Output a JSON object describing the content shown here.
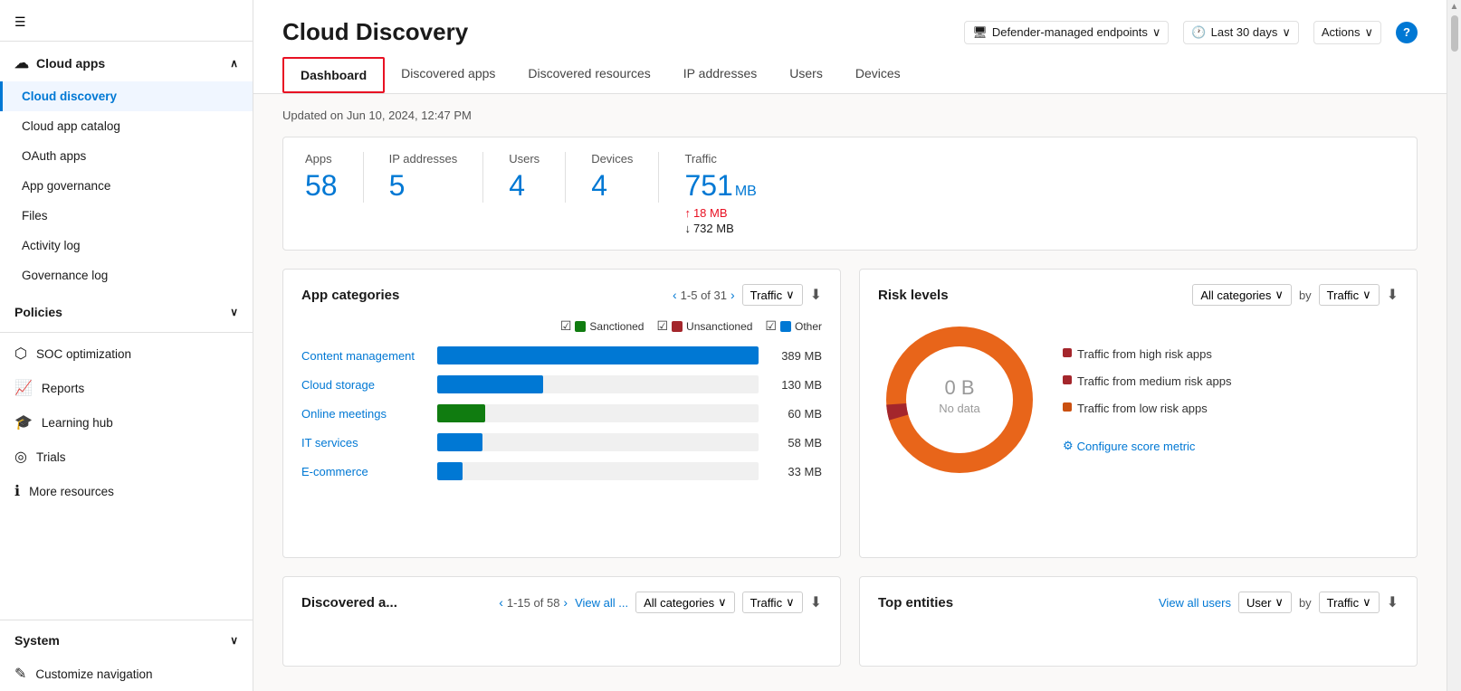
{
  "sidebar": {
    "hamburger": "☰",
    "cloud_apps": {
      "label": "Cloud apps",
      "icon": "☁",
      "chevron": "∧"
    },
    "items": [
      {
        "id": "cloud-discovery",
        "label": "Cloud discovery",
        "active": true
      },
      {
        "id": "cloud-app-catalog",
        "label": "Cloud app catalog",
        "active": false
      },
      {
        "id": "oauth-apps",
        "label": "OAuth apps",
        "active": false
      },
      {
        "id": "app-governance",
        "label": "App governance",
        "active": false
      },
      {
        "id": "files",
        "label": "Files",
        "active": false
      },
      {
        "id": "activity-log",
        "label": "Activity log",
        "active": false
      },
      {
        "id": "governance-log",
        "label": "Governance log",
        "active": false
      }
    ],
    "policies": {
      "label": "Policies",
      "chevron": "∨"
    },
    "divider1": true,
    "nav_items": [
      {
        "id": "soc-optimization",
        "label": "SOC optimization",
        "icon": "⬡"
      },
      {
        "id": "reports",
        "label": "Reports",
        "icon": "📈"
      },
      {
        "id": "learning-hub",
        "label": "Learning hub",
        "icon": "🎓"
      },
      {
        "id": "trials",
        "label": "Trials",
        "icon": "⊙"
      },
      {
        "id": "more-resources",
        "label": "More resources",
        "icon": "ℹ"
      }
    ],
    "divider2": true,
    "system": {
      "label": "System",
      "chevron": "∨"
    },
    "customize": {
      "label": "Customize navigation",
      "icon": "✎"
    }
  },
  "header": {
    "title": "Cloud Discovery",
    "updated_text": "Updated on Jun 10, 2024, 12:47 PM",
    "endpoints_btn": "Defender-managed endpoints",
    "time_btn": "Last 30 days",
    "actions_btn": "Actions",
    "help_label": "?"
  },
  "tabs": [
    {
      "id": "dashboard",
      "label": "Dashboard",
      "active": true
    },
    {
      "id": "discovered-apps",
      "label": "Discovered apps",
      "active": false
    },
    {
      "id": "discovered-resources",
      "label": "Discovered resources",
      "active": false
    },
    {
      "id": "ip-addresses",
      "label": "IP addresses",
      "active": false
    },
    {
      "id": "users",
      "label": "Users",
      "active": false
    },
    {
      "id": "devices",
      "label": "Devices",
      "active": false
    }
  ],
  "stats": [
    {
      "id": "apps",
      "label": "Apps",
      "value": "58"
    },
    {
      "id": "ip-addresses",
      "label": "IP addresses",
      "value": "5"
    },
    {
      "id": "users",
      "label": "Users",
      "value": "4"
    },
    {
      "id": "devices",
      "label": "Devices",
      "value": "4"
    },
    {
      "id": "traffic",
      "label": "Traffic",
      "value": "751",
      "unit": "MB",
      "up": "18 MB",
      "down": "732 MB"
    }
  ],
  "app_categories": {
    "title": "App categories",
    "pagination": "1-5 of 31",
    "filter": "Traffic",
    "legend": [
      {
        "label": "Sanctioned",
        "color": "#107c10"
      },
      {
        "label": "Unsanctioned",
        "color": "#a4262c"
      },
      {
        "label": "Other",
        "color": "#0078d4"
      }
    ],
    "bars": [
      {
        "label": "Content management",
        "value": "389 MB",
        "width_pct": 100,
        "color": "#0078d4"
      },
      {
        "label": "Cloud storage",
        "value": "130 MB",
        "width_pct": 33,
        "color": "#0078d4"
      },
      {
        "label": "Online meetings",
        "value": "60 MB",
        "width_pct": 15,
        "color": "#107c10"
      },
      {
        "label": "IT services",
        "value": "58 MB",
        "width_pct": 14,
        "color": "#0078d4"
      },
      {
        "label": "E-commerce",
        "value": "33 MB",
        "width_pct": 8,
        "color": "#0078d4"
      }
    ]
  },
  "risk_levels": {
    "title": "Risk levels",
    "categories_filter": "All categories",
    "by_filter": "Traffic",
    "donut": {
      "value": "0 B",
      "label": "No data"
    },
    "legend": [
      {
        "label": "Traffic from high risk apps",
        "color": "#a4262c"
      },
      {
        "label": "Traffic from medium risk apps",
        "color": "#a4262c"
      },
      {
        "label": "Traffic from low risk apps",
        "color": "#ca5010"
      }
    ],
    "configure_link": "Configure score metric"
  },
  "discovered_apps": {
    "title": "Discovered a...",
    "pagination": "1-15 of 58",
    "view_all": "View all ...",
    "filter1": "All categories",
    "filter2": "Traffic"
  },
  "top_entities": {
    "title": "Top entities",
    "view_all": "View all users",
    "filter1": "User",
    "filter2": "Traffic",
    "by": "by"
  }
}
